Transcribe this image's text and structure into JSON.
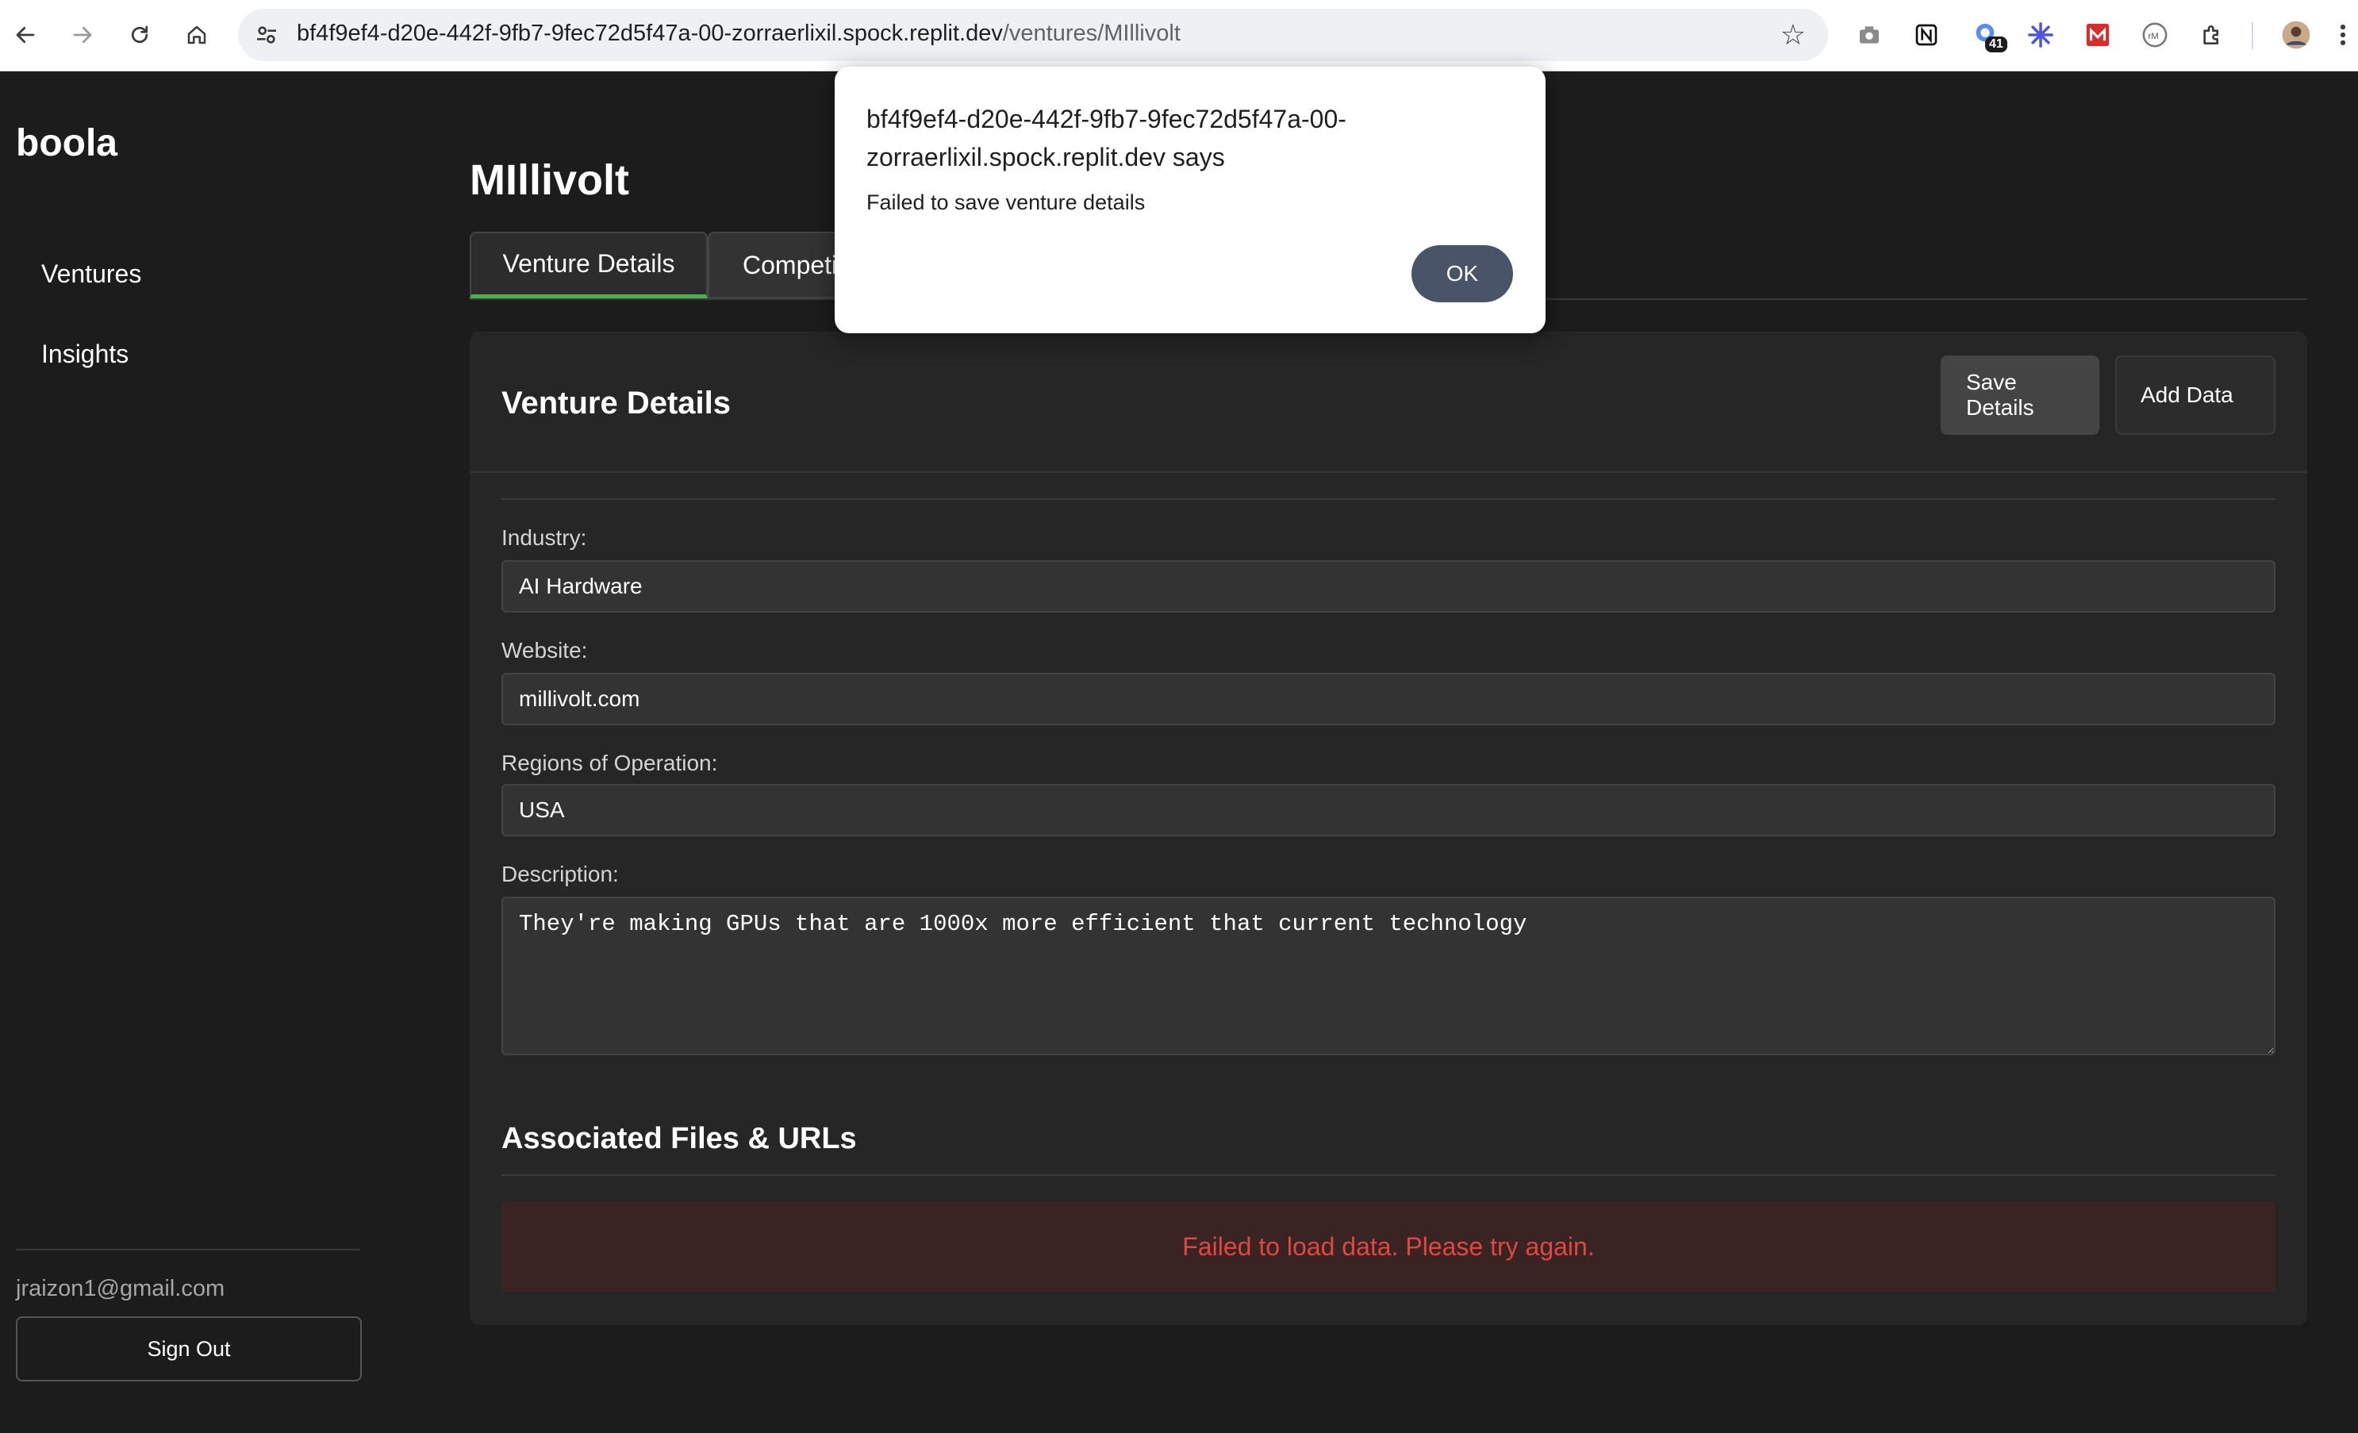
{
  "browser": {
    "url_host": "bf4f9ef4-d20e-442f-9fb7-9fec72d5f47a-00-zorraerlixil.spock.replit.dev",
    "url_path": "/ventures/MIllivolt",
    "extension_badge": "41"
  },
  "sidebar": {
    "brand": "boola",
    "items": [
      {
        "label": "Ventures"
      },
      {
        "label": "Insights"
      }
    ],
    "user_email": "jraizon1@gmail.com",
    "signout_label": "Sign Out"
  },
  "main": {
    "title": "MIllivolt",
    "tabs": [
      {
        "label": "Venture Details",
        "active": true
      },
      {
        "label": "Competi",
        "active": false
      }
    ],
    "card": {
      "title": "Venture Details",
      "save_label": "Save Details",
      "add_label": "Add Data",
      "fields": {
        "industry": {
          "label": "Industry:",
          "value": "AI Hardware"
        },
        "website": {
          "label": "Website:",
          "value": "millivolt.com"
        },
        "regions": {
          "label": "Regions of Operation:",
          "value": "USA"
        },
        "description": {
          "label": "Description:",
          "value": "They're making GPUs that are 1000x more efficient that current technology"
        }
      },
      "files_title": "Associated Files & URLs",
      "error_message": "Failed to load data. Please try again."
    }
  },
  "dialog": {
    "title": "bf4f9ef4-d20e-442f-9fb7-9fec72d5f47a-00-zorraerlixil.spock.replit.dev says",
    "message": "Failed to save venture details",
    "ok_label": "OK"
  },
  "colors": {
    "background": "#1c1c1c",
    "card": "#262626",
    "active_tab_accent": "#4caf50",
    "error_text": "#e0483f",
    "dialog_button": "#495468"
  }
}
